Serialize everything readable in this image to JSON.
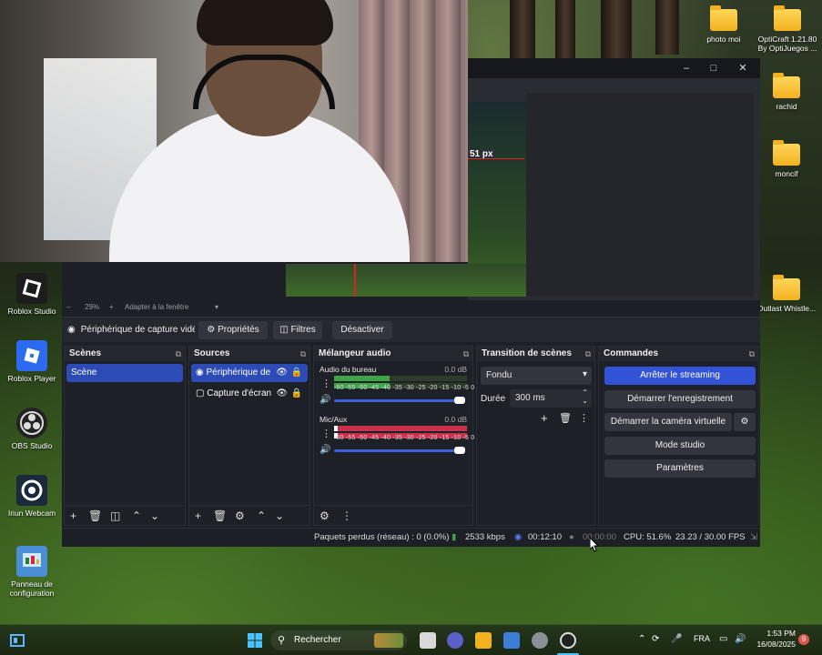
{
  "desktop": {
    "icons_right": [
      {
        "label": "photo moi"
      },
      {
        "label": "OptiCraft 1.21.80 By OptiJuegos ..."
      },
      {
        "label": "rachid"
      },
      {
        "label": "moncif"
      },
      {
        "label": "Outlast Whistle..."
      }
    ],
    "icons_left": [
      {
        "label": "Roblox Studio"
      },
      {
        "label": "Roblox Player"
      },
      {
        "label": "OBS Studio"
      },
      {
        "label": "Iriun Webcam"
      },
      {
        "label": "Panneau de configuration"
      }
    ]
  },
  "obs": {
    "preview": {
      "px_label": "51 px"
    },
    "zoom": {
      "percent": "29%",
      "fit_label": "Adapter à la fenêtre"
    },
    "source_bar": {
      "source_name": "Périphérique de capture vidéo",
      "properties_label": "Propriétés",
      "filters_label": "Filtres",
      "disable_label": "Désactiver"
    },
    "scenes": {
      "title": "Scènes",
      "items": [
        "Scène"
      ]
    },
    "sources": {
      "title": "Sources",
      "items": [
        "Périphérique de",
        "Capture d'écran"
      ]
    },
    "mixer": {
      "title": "Mélangeur audio",
      "channels": [
        {
          "name": "Audio du bureau",
          "db": "0.0 dB",
          "level": 0.42
        },
        {
          "name": "Mic/Aux",
          "db": "0.0 dB",
          "level": 0.03
        }
      ],
      "ticks": "-60 -55 -50 -45 -40 -35 -30 -25 -20 -15 -10 -5 0"
    },
    "transitions": {
      "title": "Transition de scènes",
      "type": "Fondu",
      "duration_label": "Durée",
      "duration_value": "300 ms"
    },
    "controls": {
      "title": "Commandes",
      "stop_streaming": "Arrêter le streaming",
      "start_recording": "Démarrer l'enregistrement",
      "start_virtual_cam": "Démarrer la caméra virtuelle",
      "studio_mode": "Mode studio",
      "settings": "Paramètres"
    },
    "status": {
      "dropped_frames": "Paquets perdus (réseau) : 0 (0.0%)",
      "bitrate": "2533 kbps",
      "stream_time": "00:12:10",
      "record_time": "00:00:00",
      "cpu": "CPU: 51.6%",
      "fps": "23.23 / 30.00 FPS"
    }
  },
  "taskbar": {
    "search_label": "Rechercher",
    "language": "FRA",
    "time": "1:53 PM",
    "date": "16/08/2025",
    "notification_count": "9"
  },
  "colors": {
    "accent": "#3253d6",
    "obs_bg": "#1d1f26",
    "meter_green": "#3fa447",
    "meter_red": "#c7324a"
  }
}
